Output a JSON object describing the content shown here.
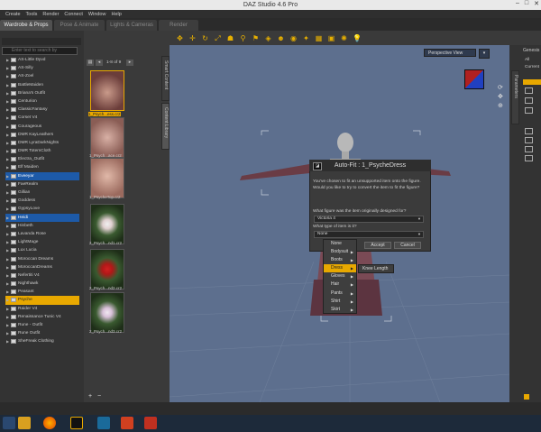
{
  "window": {
    "title": "DAZ Studio 4.6 Pro"
  },
  "menu": [
    "Create",
    "Tools",
    "Render",
    "Connect",
    "Window",
    "Help"
  ],
  "tabs": [
    "Wardrobe & Props",
    "Pose & Animate",
    "Lights & Cameras",
    "Render"
  ],
  "left_panel": {
    "search_placeholder": "Enter text to search by",
    "folders": [
      "AS-Little Dyvd",
      "AS-Silly",
      "AS-Zoel",
      "BattleMaiden",
      "Briana's Outfit",
      "Centurion",
      "ClassicFantasy",
      "Corset V4",
      "Courageous",
      "DMR KayLeathers",
      "DMR LyraDarkNights",
      "DMR TotemCloth",
      "Electra_Outfit",
      "Elf Maiden",
      "Eveeyar",
      "FaeRealm",
      "Gillian",
      "Goddess",
      "GypsyLove",
      "Heidi",
      "Hinbeth",
      "Lavanda Rose",
      "LightMage",
      "Lux Lucia",
      "Moroccan Dreams",
      "MoroccanDreams",
      "Nefertiti V4",
      "Nighthawk",
      "Peasant",
      "Psyche",
      "Raider V4",
      "Renaissance Tunic V4",
      "Rune - Outfit",
      "Rune Outfit",
      "SheFreak Clothing"
    ]
  },
  "thumbs": {
    "page_info": "1-8 of 9",
    "labels": [
      "1_Psych...ess.cr2",
      "1_Psych...ace.cr2",
      "1_PsycheTop.cr2",
      "2_Psych...nd1.cr2",
      "2_Psych...nd2.cr2",
      "2_Psych...nd3.cr2"
    ],
    "add": "+",
    "remove": "−"
  },
  "side_tabs": {
    "left": [
      "Smart Content",
      "Content Library"
    ],
    "right": [
      "Parameters"
    ]
  },
  "viewport": {
    "camera": "Perspective View"
  },
  "dialog": {
    "title": "Auto-Fit : 1_PsycheDress",
    "message1": "You've chosen to fit an unsupported item onto the figure.",
    "message2": "Would you like to try to convert the item to fit the figure?",
    "q1": "What figure was the item originally designed for?",
    "figure": "Victoria 4",
    "q2": "What type of item is it?",
    "item_type": "None",
    "accept": "Accept",
    "cancel": "Cancel"
  },
  "type_menu": [
    "None",
    "Bodysuit",
    "Boots",
    "Dress",
    "Gloves",
    "Hair",
    "Pants",
    "Shirt",
    "Skirt"
  ],
  "sub_menu": [
    "Knee Length"
  ],
  "right_panel": {
    "header": "Genesis",
    "items": [
      "All",
      "Current"
    ]
  },
  "colors": {
    "accent": "#e8a800",
    "selection": "#1d5aa8",
    "viewport": "#5d6f8e"
  }
}
